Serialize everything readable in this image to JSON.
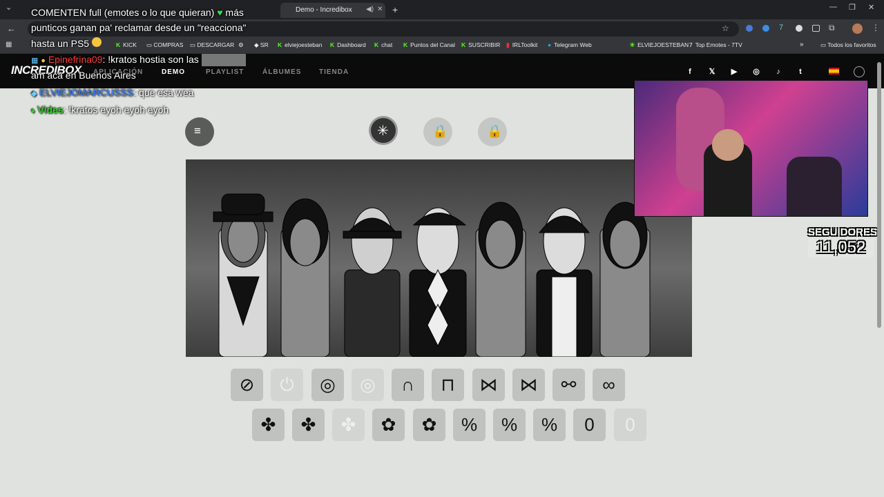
{
  "browser": {
    "tabs": [
      {
        "label": "Demo - Incredibox",
        "active": true
      }
    ],
    "bookmarks": [
      "SR",
      "elviejoesteban",
      "Dashboard",
      "chat",
      "Puntos del Canal",
      "SUSCRIBIR",
      "IRLToolkit",
      "Telegram Web",
      "ELVIEJOESTEBAN",
      "Top Emotes - 7TV"
    ],
    "bookmarks_other": [
      "KICK",
      "COMPRAS",
      "DESCARGAR"
    ],
    "all_bookmarks": "Todos los favoritos",
    "kick_prefix": "K"
  },
  "site": {
    "logo": "INCREDIBOX",
    "nav": [
      "APLICACIÓN",
      "DEMO",
      "PLAYLIST",
      "ÁLBUMES",
      "TIENDA"
    ],
    "nav_active": "DEMO",
    "socials": [
      "f",
      "𝕏",
      "▶",
      "◎",
      "♪",
      "t"
    ]
  },
  "stream_overlay": {
    "top_message_lines": [
      "COMENTEN full (emotes o lo que quieran)",
      "más",
      "punticos ganan pa' reclamar desde un \"reacciona\"",
      "hasta un PS5"
    ],
    "chat": [
      {
        "user": "Epinefrina09",
        "text": ": !kratos hostia son las",
        "text2": "am acá en Buenos Aires",
        "color": "#ff3b3b"
      },
      {
        "user": "ELVIEJOMARCUSSS",
        "text": ": que esa wea",
        "color": "#2f7dff"
      },
      {
        "user": "Vides",
        "text": ": !kratos eyoh eyoh eyoh",
        "color": "#33d02a"
      }
    ],
    "followers_label": "SEGUIDORES",
    "followers_count": "11,052"
  },
  "icons": {
    "row1": [
      "target",
      "power",
      "ring",
      "ring-faded",
      "arch",
      "banner",
      "crown",
      "bow",
      "knot",
      "loops"
    ],
    "row2": [
      "clover",
      "clover",
      "clover-faded",
      "flower",
      "flower",
      "percent",
      "percent",
      "percent",
      "double-o",
      "double-o-faded"
    ]
  }
}
